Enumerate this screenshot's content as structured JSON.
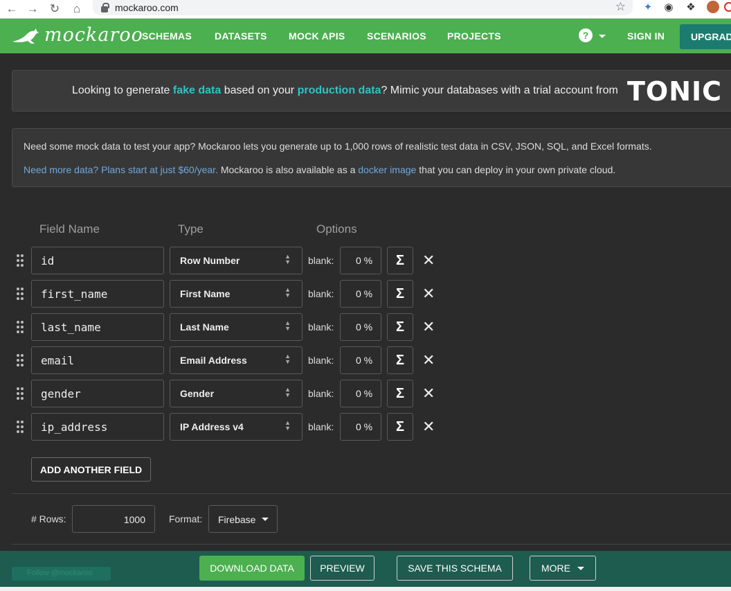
{
  "browser": {
    "url": "mockaroo.com"
  },
  "nav": {
    "logo": "mockaroo",
    "links": [
      "SCHEMAS",
      "DATASETS",
      "MOCK APIS",
      "SCENARIOS",
      "PROJECTS"
    ],
    "help": "?",
    "sign_in": "SIGN IN",
    "upgrade": "UPGRADE"
  },
  "banner": {
    "pre": "Looking to generate ",
    "hl1": "fake data",
    "mid": " based on your ",
    "hl2": "production data",
    "post": "? Mimic your databases with a trial account from",
    "brand": "TONIC"
  },
  "info": {
    "line1": "Need some mock data to test your app? Mockaroo lets you generate up to 1,000 rows of realistic test data in CSV, JSON, SQL, and Excel formats.",
    "plans_link": "Need more data? Plans start at just $60/year.",
    "mid": " Mockaroo is also available as a ",
    "docker_link": "docker image",
    "post": " that you can deploy in your own private cloud."
  },
  "columns": {
    "field_name": "Field Name",
    "type": "Type",
    "options": "Options"
  },
  "fields": [
    {
      "name": "id",
      "type": "Row Number",
      "blank_label": "blank:",
      "blank": "0 %"
    },
    {
      "name": "first_name",
      "type": "First Name",
      "blank_label": "blank:",
      "blank": "0 %"
    },
    {
      "name": "last_name",
      "type": "Last Name",
      "blank_label": "blank:",
      "blank": "0 %"
    },
    {
      "name": "email",
      "type": "Email Address",
      "blank_label": "blank:",
      "blank": "0 %"
    },
    {
      "name": "gender",
      "type": "Gender",
      "blank_label": "blank:",
      "blank": "0 %"
    },
    {
      "name": "ip_address",
      "type": "IP Address v4",
      "blank_label": "blank:",
      "blank": "0 %"
    }
  ],
  "add_field": "ADD ANOTHER FIELD",
  "settings": {
    "rows_label": "# Rows:",
    "rows": "1000",
    "format_label": "Format:",
    "format": "Firebase"
  },
  "footer": {
    "follow": "Follow @mockaroo",
    "download": "DOWNLOAD DATA",
    "preview": "PREVIEW",
    "save": "SAVE THIS SCHEMA",
    "more": "MORE"
  },
  "colors": {
    "brand_green": "#4caf50",
    "footer_teal": "#1d5c4f",
    "highlight": "#2ec4c4",
    "link": "#6fa8dc"
  }
}
